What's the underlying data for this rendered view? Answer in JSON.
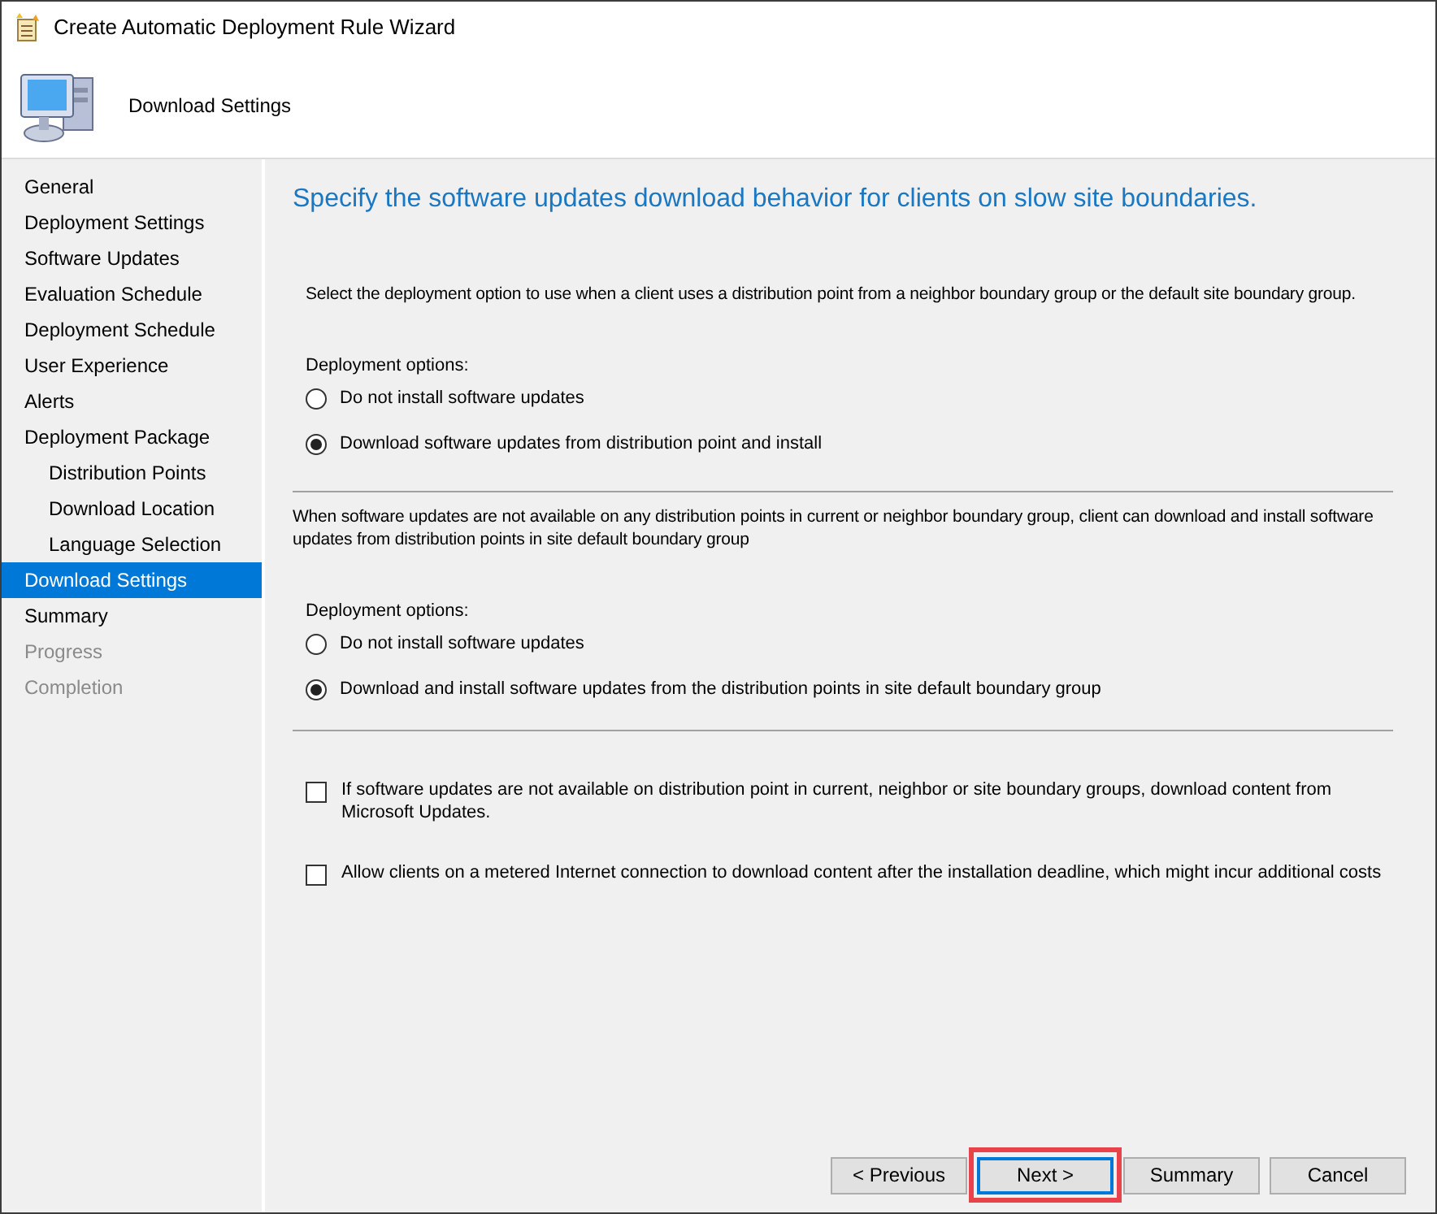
{
  "window": {
    "title": "Create Automatic Deployment Rule Wizard"
  },
  "header": {
    "title": "Download Settings"
  },
  "steps": [
    {
      "label": "General",
      "selected": false,
      "disabled": false
    },
    {
      "label": "Deployment Settings",
      "selected": false,
      "disabled": false
    },
    {
      "label": "Software Updates",
      "selected": false,
      "disabled": false
    },
    {
      "label": "Evaluation Schedule",
      "selected": false,
      "disabled": false
    },
    {
      "label": "Deployment Schedule",
      "selected": false,
      "disabled": false
    },
    {
      "label": "User Experience",
      "selected": false,
      "disabled": false
    },
    {
      "label": "Alerts",
      "selected": false,
      "disabled": false
    },
    {
      "label": "Deployment Package",
      "selected": false,
      "disabled": false,
      "children": [
        {
          "label": "Distribution Points",
          "selected": false,
          "disabled": false
        },
        {
          "label": "Download Location",
          "selected": false,
          "disabled": false
        },
        {
          "label": "Language Selection",
          "selected": false,
          "disabled": false
        }
      ]
    },
    {
      "label": "Download Settings",
      "selected": true,
      "disabled": false
    },
    {
      "label": "Summary",
      "selected": false,
      "disabled": false
    },
    {
      "label": "Progress",
      "selected": false,
      "disabled": true
    },
    {
      "label": "Completion",
      "selected": false,
      "disabled": true
    }
  ],
  "heading": "Specify the software updates download behavior for clients on slow site boundaries.",
  "sections": [
    {
      "description": "Select the deployment option to use when a client uses a distribution point from a neighbor boundary group or the default site boundary group.",
      "options_label": "Deployment options:",
      "options": [
        {
          "label": "Do not install software updates",
          "selected": false
        },
        {
          "label": "Download software updates from distribution point and install",
          "selected": true
        }
      ]
    },
    {
      "description": "When software updates are not available on any distribution points in current or neighbor boundary group, client can download and install software updates from distribution points in site default boundary group",
      "options_label": "Deployment options:",
      "options": [
        {
          "label": "Do not install software updates",
          "selected": false
        },
        {
          "label": "Download and install software updates from the distribution points in site default boundary group",
          "selected": true
        }
      ]
    }
  ],
  "checkboxes": [
    {
      "label": "If software updates are not available on distribution point in current, neighbor or site boundary groups, download content from Microsoft Updates.",
      "checked": false
    },
    {
      "label": "Allow clients on a metered Internet connection to download content after the installation deadline, which might incur additional costs",
      "checked": false
    }
  ],
  "buttons": [
    {
      "label": "< Previous",
      "default": false,
      "highlighted": false
    },
    {
      "label": "Next >",
      "default": true,
      "highlighted": true
    },
    {
      "label": "Summary",
      "default": false,
      "highlighted": false
    },
    {
      "label": "Cancel",
      "default": false,
      "highlighted": false
    }
  ]
}
